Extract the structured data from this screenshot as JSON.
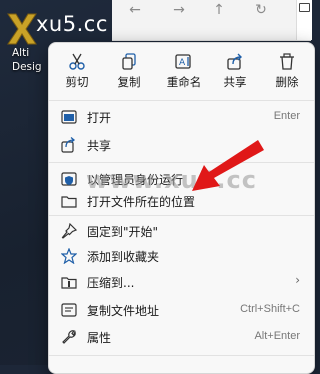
{
  "site": {
    "name": "xu5.cc"
  },
  "desktop_icon": {
    "label_line1": "Alti",
    "label_line2": "Desig"
  },
  "explorer": {
    "back_icon": "arrow-left-icon",
    "forward_icon": "arrow-right-icon",
    "up_icon": "arrow-up-icon",
    "refresh_icon": "refresh-icon"
  },
  "toolbar": {
    "cut": "剪切",
    "copy": "复制",
    "rename": "重命名",
    "share": "共享",
    "delete": "删除"
  },
  "menu": {
    "items": [
      {
        "label": "打开",
        "shortcut": "Enter",
        "icon": "open-icon"
      },
      {
        "label": "共享",
        "shortcut": "",
        "icon": "share-icon"
      },
      {
        "label": "以管理员身份运行",
        "shortcut": "",
        "icon": "shield-icon"
      },
      {
        "label": "打开文件所在的位置",
        "shortcut": "",
        "icon": "folder-icon"
      },
      {
        "label": "固定到\"开始\"",
        "shortcut": "",
        "icon": "pin-icon"
      },
      {
        "label": "添加到收藏夹",
        "shortcut": "",
        "icon": "star-icon"
      },
      {
        "label": "压缩到...",
        "shortcut": "",
        "icon": "zip-folder-icon",
        "has_submenu": true
      },
      {
        "label": "复制文件地址",
        "shortcut": "Ctrl+Shift+C",
        "icon": "copy-path-icon"
      },
      {
        "label": "属性",
        "shortcut": "Alt+Enter",
        "icon": "wrench-icon"
      }
    ]
  },
  "watermark": "www.xu5.cc",
  "colors": {
    "accent": "#0067c0",
    "arrow": "#e01818",
    "menu_bg": "#f8f8f8"
  }
}
